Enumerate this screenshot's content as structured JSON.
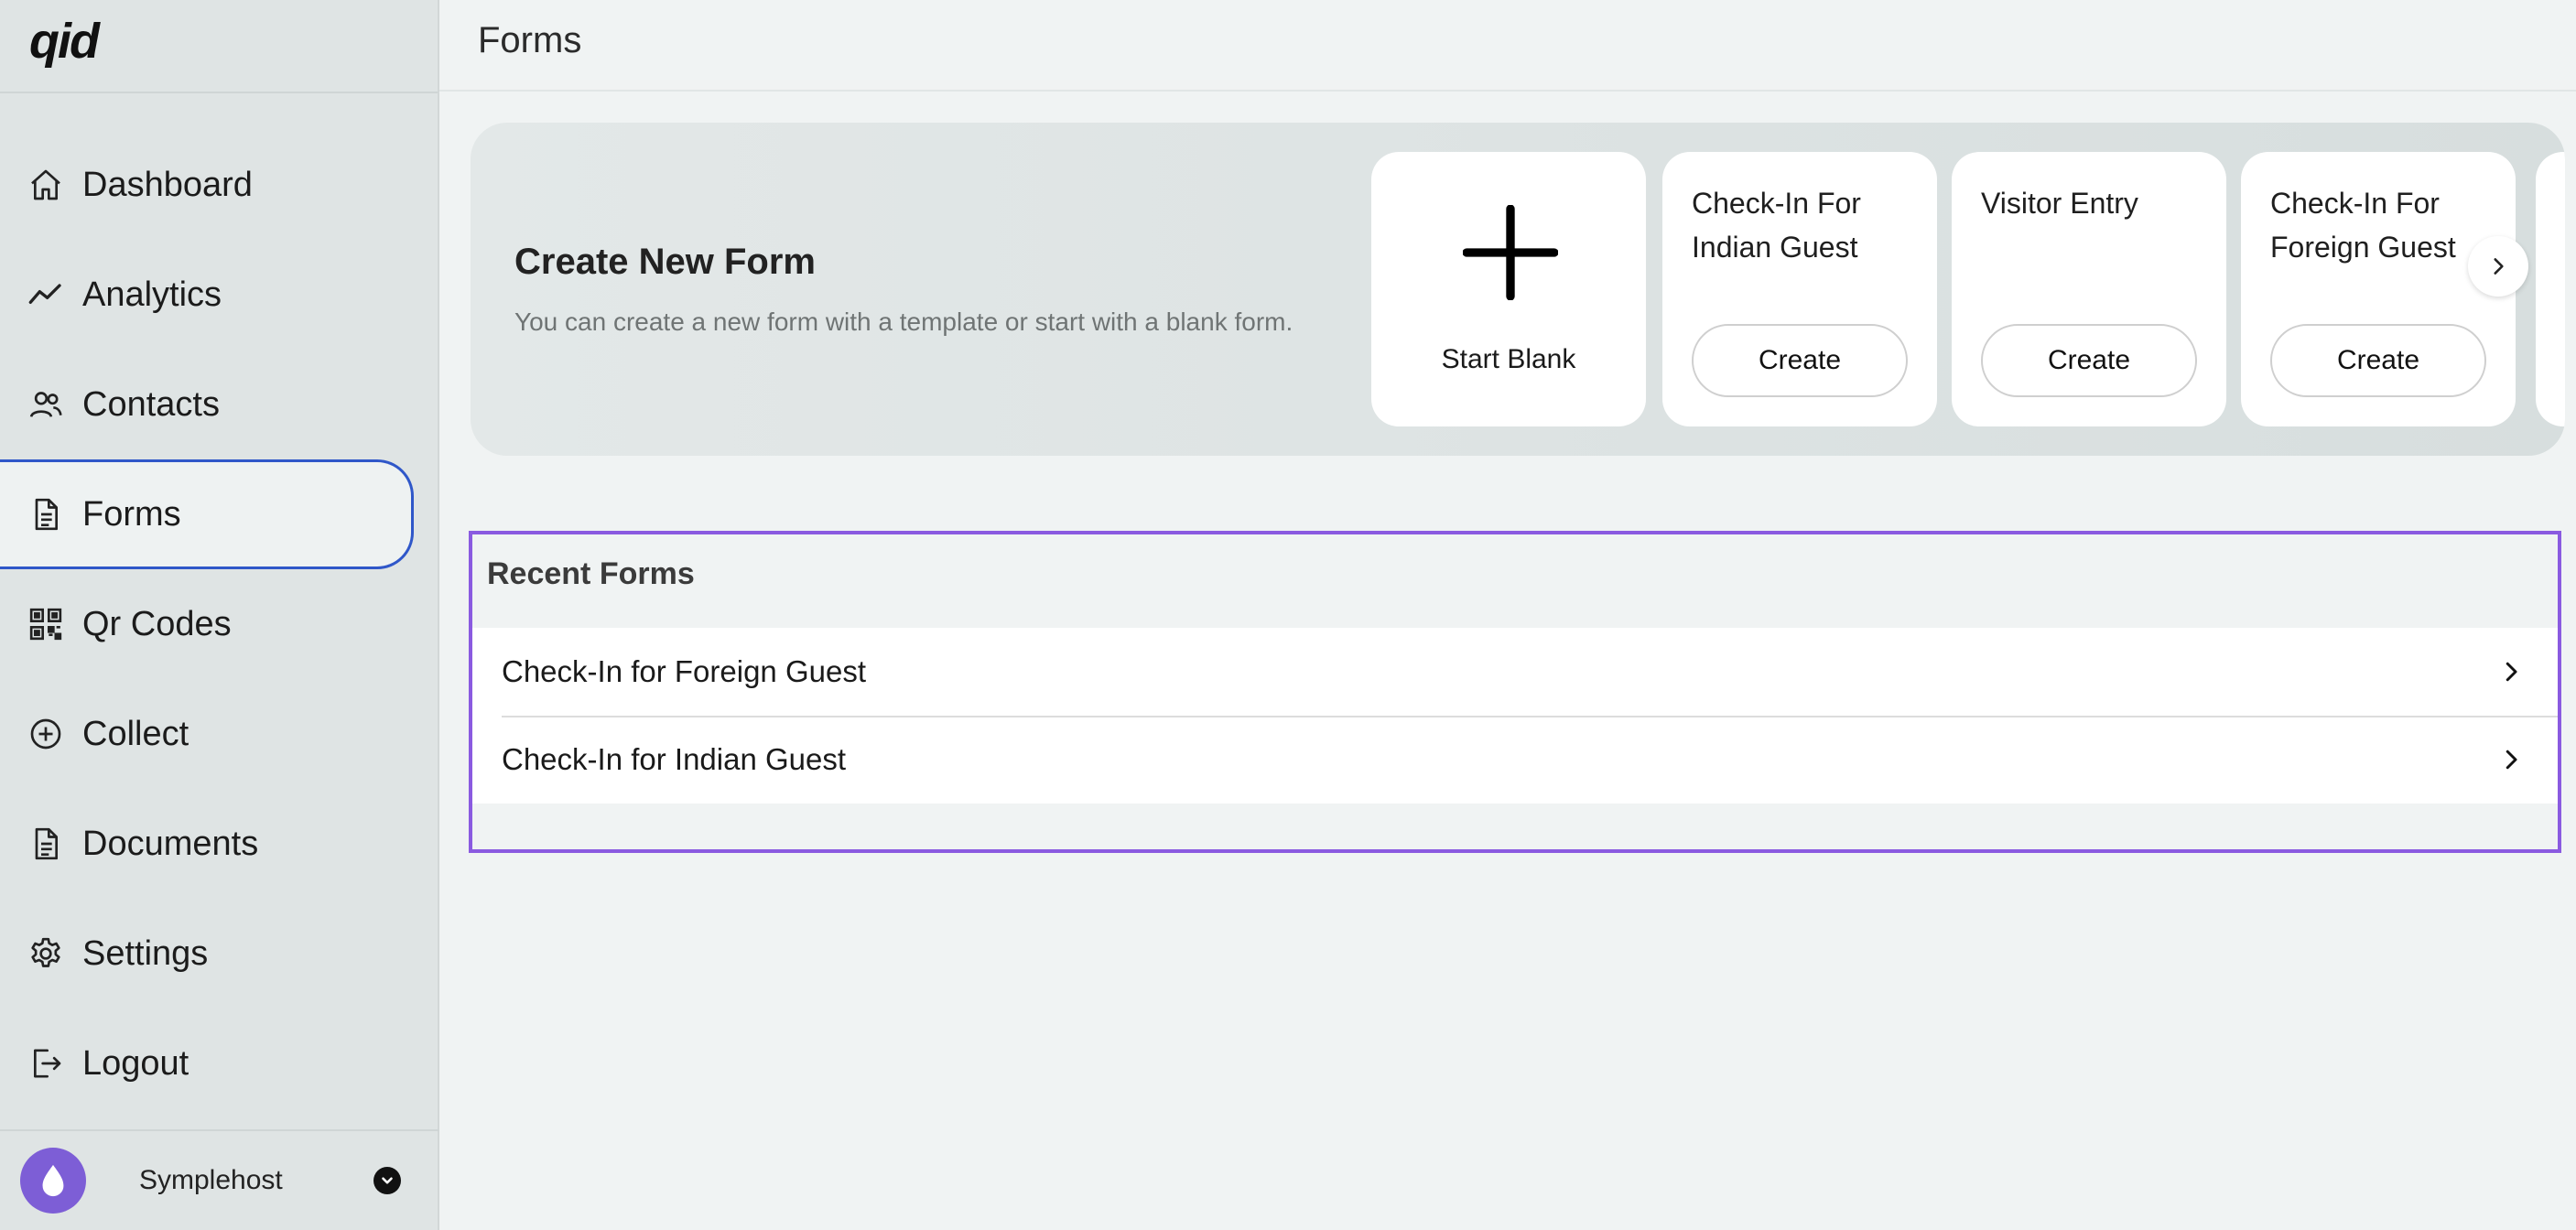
{
  "sidebar": {
    "logo": "qid",
    "items": [
      {
        "label": "Dashboard",
        "icon": "home-icon"
      },
      {
        "label": "Analytics",
        "icon": "trend-line-icon"
      },
      {
        "label": "Contacts",
        "icon": "users-icon"
      },
      {
        "label": "Forms",
        "icon": "document-icon",
        "active": true
      },
      {
        "label": "Qr Codes",
        "icon": "qr-code-icon"
      },
      {
        "label": "Collect",
        "icon": "plus-circle-icon"
      },
      {
        "label": "Documents",
        "icon": "document-icon"
      },
      {
        "label": "Settings",
        "icon": "gear-icon"
      },
      {
        "label": "Logout",
        "icon": "logout-icon"
      }
    ],
    "profile": {
      "name": "Symplehost",
      "avatar_color": "#7d5ed6"
    }
  },
  "header": {
    "title": "Forms"
  },
  "create_panel": {
    "title": "Create New Form",
    "subtitle": "You can create a new form with a template or start with a blank form.",
    "blank_label": "Start Blank",
    "templates": [
      {
        "title": "Check-In For Indian Guest",
        "button": "Create"
      },
      {
        "title": "Visitor Entry",
        "button": "Create"
      },
      {
        "title": "Check-In For Foreign Guest",
        "button": "Create"
      }
    ]
  },
  "recent_forms": {
    "title": "Recent Forms",
    "items": [
      "Check-In for Foreign Guest",
      "Check-In for Indian Guest"
    ]
  },
  "colors": {
    "active_border": "#2f57c9",
    "highlight_border": "#8a5ae0",
    "avatar": "#7d5ed6"
  }
}
